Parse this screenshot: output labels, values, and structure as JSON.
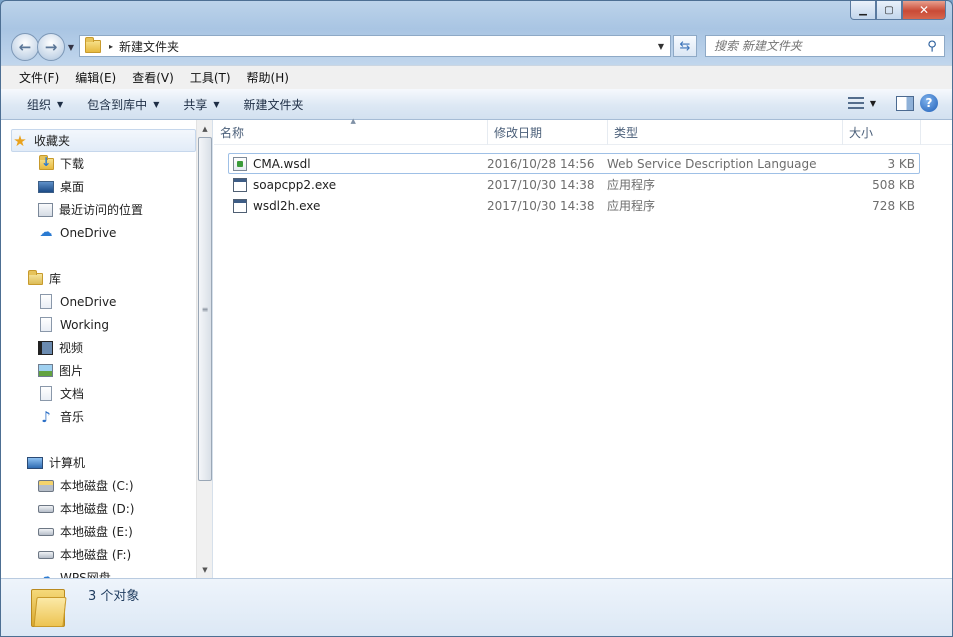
{
  "window": {
    "caption": {
      "minimize": "▁",
      "maximize": "▢",
      "close": "✕"
    }
  },
  "address": {
    "path": "新建文件夹",
    "separator": "▸"
  },
  "search": {
    "placeholder": "搜索 新建文件夹"
  },
  "menu": [
    "文件(F)",
    "编辑(E)",
    "查看(V)",
    "工具(T)",
    "帮助(H)"
  ],
  "commands": [
    {
      "label": "组织",
      "has_dropdown": true
    },
    {
      "label": "包含到库中",
      "has_dropdown": true
    },
    {
      "label": "共享",
      "has_dropdown": true
    },
    {
      "label": "新建文件夹",
      "has_dropdown": false
    }
  ],
  "nav": {
    "favorites": {
      "label": "收藏夹",
      "items": [
        {
          "label": "下载",
          "icon": "downloads-folder-icon"
        },
        {
          "label": "桌面",
          "icon": "desktop-icon"
        },
        {
          "label": "最近访问的位置",
          "icon": "recent-places-icon"
        },
        {
          "label": "OneDrive",
          "icon": "onedrive-cloud-icon"
        }
      ]
    },
    "libraries": {
      "label": "库",
      "items": [
        {
          "label": "OneDrive",
          "icon": "document-icon"
        },
        {
          "label": "Working",
          "icon": "document-icon"
        },
        {
          "label": "视频",
          "icon": "video-icon"
        },
        {
          "label": "图片",
          "icon": "picture-icon"
        },
        {
          "label": "文档",
          "icon": "document-icon"
        },
        {
          "label": "音乐",
          "icon": "music-icon"
        }
      ]
    },
    "computer": {
      "label": "计算机",
      "items": [
        {
          "label": "本地磁盘 (C:)",
          "icon": "system-drive-icon"
        },
        {
          "label": "本地磁盘 (D:)",
          "icon": "drive-icon"
        },
        {
          "label": "本地磁盘 (E:)",
          "icon": "drive-icon"
        },
        {
          "label": "本地磁盘 (F:)",
          "icon": "drive-icon"
        },
        {
          "label": "WPS网盘",
          "icon": "cloud-drive-icon"
        }
      ]
    }
  },
  "columns": {
    "name": "名称",
    "date": "修改日期",
    "type": "类型",
    "size": "大小"
  },
  "files": [
    {
      "name": "CMA.wsdl",
      "date": "2016/10/28 14:56",
      "type": "Web Service Description Language",
      "size": "3 KB",
      "icon": "wsdl-file-icon"
    },
    {
      "name": "soapcpp2.exe",
      "date": "2017/10/30 14:38",
      "type": "应用程序",
      "size": "508 KB",
      "icon": "exe-file-icon"
    },
    {
      "name": "wsdl2h.exe",
      "date": "2017/10/30 14:38",
      "type": "应用程序",
      "size": "728 KB",
      "icon": "exe-file-icon"
    }
  ],
  "details": {
    "count": "3 个对象"
  }
}
